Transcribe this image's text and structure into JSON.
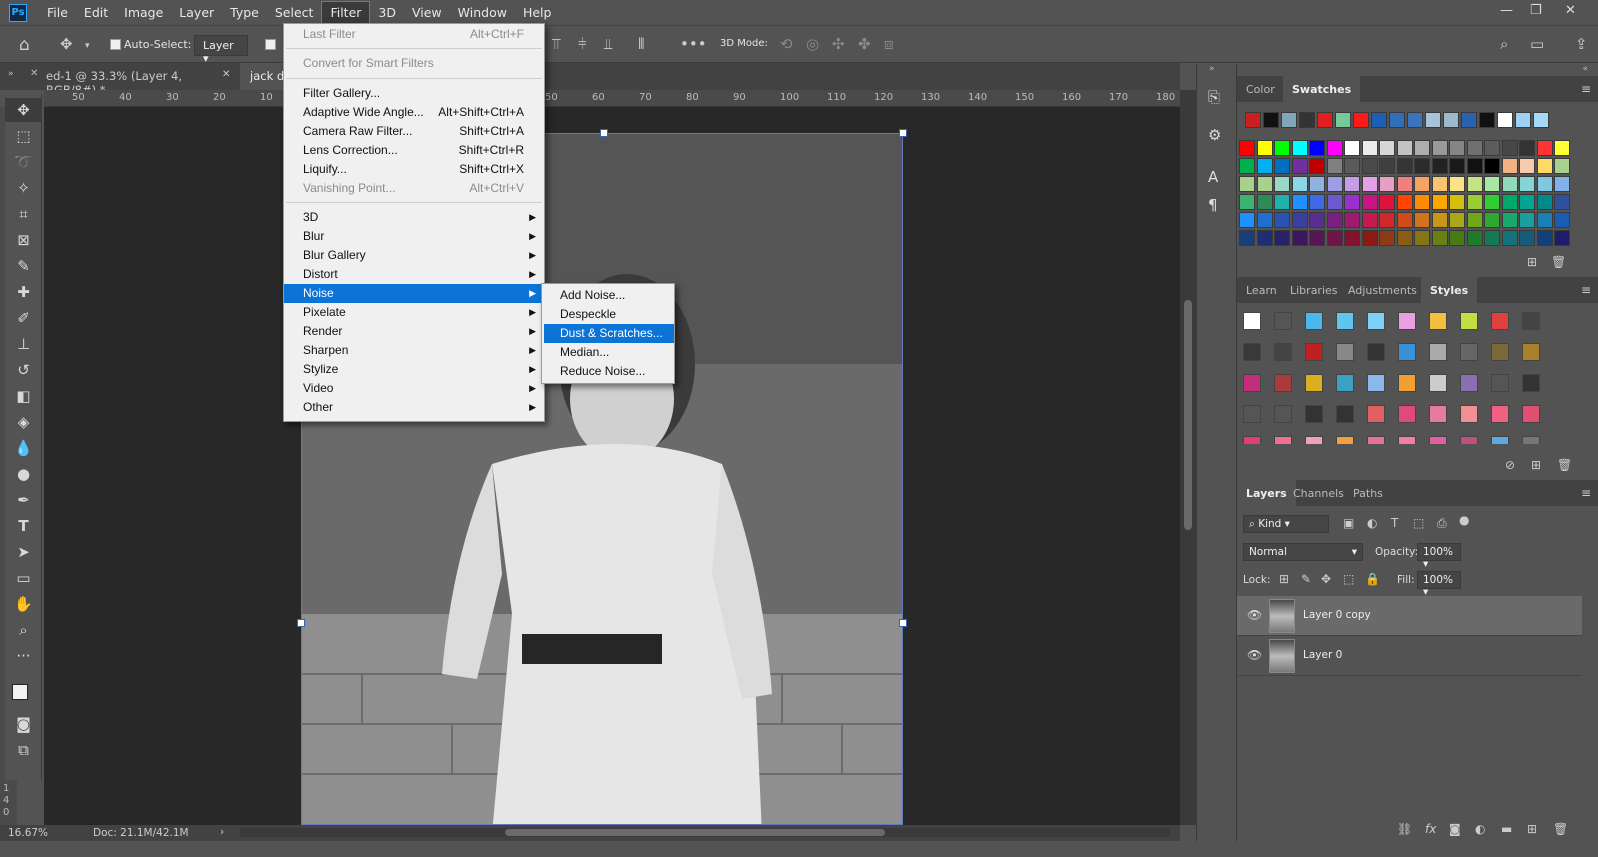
{
  "menubar": {
    "logo": "Ps",
    "items": [
      "File",
      "Edit",
      "Image",
      "Layer",
      "Type",
      "Select",
      "Filter",
      "3D",
      "View",
      "Window",
      "Help"
    ]
  },
  "options": {
    "auto_select_label": "Auto-Select:",
    "auto_select_value": "Layer",
    "mode_label": "3D Mode:"
  },
  "doc_tabs": [
    "ed-1 @ 33.3% (Layer 4, RGB/8#) *",
    "jack da"
  ],
  "ruler_h": [
    "50",
    "40",
    "30",
    "20",
    "10",
    "50",
    "60",
    "70",
    "80",
    "90",
    "100",
    "110",
    "120",
    "130",
    "140",
    "150",
    "160",
    "170",
    "180"
  ],
  "ruler_v": [
    "1",
    "4",
    "0"
  ],
  "filter_menu": {
    "items": [
      {
        "label": "Last Filter",
        "shortcut": "Alt+Ctrl+F",
        "disabled": true
      },
      {
        "label": "Convert for Smart Filters",
        "disabled": true
      },
      {
        "label": "Filter Gallery..."
      },
      {
        "label": "Adaptive Wide Angle...",
        "shortcut": "Alt+Shift+Ctrl+A"
      },
      {
        "label": "Camera Raw Filter...",
        "shortcut": "Shift+Ctrl+A"
      },
      {
        "label": "Lens Correction...",
        "shortcut": "Shift+Ctrl+R"
      },
      {
        "label": "Liquify...",
        "shortcut": "Shift+Ctrl+X"
      },
      {
        "label": "Vanishing Point...",
        "shortcut": "Alt+Ctrl+V",
        "disabled": true
      },
      {
        "label": "3D"
      },
      {
        "label": "Blur"
      },
      {
        "label": "Blur Gallery"
      },
      {
        "label": "Distort"
      },
      {
        "label": "Noise"
      },
      {
        "label": "Pixelate"
      },
      {
        "label": "Render"
      },
      {
        "label": "Sharpen"
      },
      {
        "label": "Stylize"
      },
      {
        "label": "Video"
      },
      {
        "label": "Other"
      }
    ]
  },
  "noise_submenu": [
    "Add Noise...",
    "Despeckle",
    "Dust & Scratches...",
    "Median...",
    "Reduce Noise..."
  ],
  "status": {
    "zoom": "16.67%",
    "doc": "Doc: 21.1M/42.1M"
  },
  "panels": {
    "swatch_tabs": [
      "Color",
      "Swatches"
    ],
    "style_tabs": [
      "Learn",
      "Libraries",
      "Adjustments",
      "Styles"
    ],
    "layer_tabs": [
      "Layers",
      "Channels",
      "Paths"
    ],
    "kind_label": "Kind",
    "blend_mode": "Normal",
    "opacity_label": "Opacity:",
    "opacity_value": "100%",
    "lock_label": "Lock:",
    "fill_label": "Fill:",
    "fill_value": "100%",
    "layers": [
      "Layer 0 copy",
      "Layer 0"
    ]
  },
  "colors": {
    "recent_swatches": [
      "#cc1f1f",
      "#111111",
      "#7fa7b8",
      "#333333",
      "#e02020",
      "#78c99a",
      "#ff1a1a",
      "#1e5fb3",
      "#2f6fb8",
      "#3c74bb",
      "#a8c3d7",
      "#9fb9cc",
      "#2b62ad",
      "#111111",
      "#ffffff",
      "#9cd0f5",
      "#a6d8f7"
    ],
    "swatch_grid": [
      [
        "#ff0000",
        "#ffff00",
        "#00ff00",
        "#00ffff",
        "#0000ff",
        "#ff00ff",
        "#ffffff",
        "#ebebeb",
        "#d6d6d6",
        "#c2c2c2",
        "#adadad",
        "#999999",
        "#858585",
        "#707070",
        "#5c5c5c",
        "#474747",
        "#333333",
        "#ff3333",
        "#ffff33"
      ],
      [
        "#00b050",
        "#00b0f0",
        "#0070c0",
        "#7030a0",
        "#c00000",
        "#808080",
        "#5a5a5a",
        "#4a4a4a",
        "#3f3f3f",
        "#353535",
        "#2c2c2c",
        "#222222",
        "#1a1a1a",
        "#111111",
        "#000000",
        "#f4b183",
        "#f8cbad",
        "#ffd966",
        "#a9d18e"
      ],
      [
        "#a9d18e",
        "#a9d18e",
        "#9bd7c6",
        "#8ad5e6",
        "#8fb4e3",
        "#9e9ee6",
        "#c49ee6",
        "#e69ee6",
        "#e69ec4",
        "#f08080",
        "#f4a460",
        "#f8c471",
        "#fce38a",
        "#c5e384",
        "#a8e6a3",
        "#8fd9b6",
        "#84d6d6",
        "#7ec8e3",
        "#82b0e8"
      ],
      [
        "#3cb371",
        "#2e8b57",
        "#20b2aa",
        "#1e90ff",
        "#4169e1",
        "#6a5acd",
        "#9932cc",
        "#c71585",
        "#dc143c",
        "#ff4500",
        "#ff8c00",
        "#ffa500",
        "#d4c00c",
        "#9acd32",
        "#32cd32",
        "#00a86b",
        "#00a693",
        "#008b8b",
        "#2f4f9f"
      ],
      [
        "#1e90ff",
        "#1f6fd1",
        "#2952b3",
        "#3b3fa0",
        "#5a2d91",
        "#7a1f84",
        "#9e1a6e",
        "#c41a4f",
        "#d1262a",
        "#d14b1a",
        "#d1731a",
        "#c9961a",
        "#a8a81a",
        "#6fa81a",
        "#2fa82f",
        "#1aa86f",
        "#1a9f9f",
        "#1a7fb5",
        "#1a5cb5"
      ],
      [
        "#173f7a",
        "#1d2f6e",
        "#2a2166",
        "#3d175e",
        "#561656",
        "#6d1448",
        "#84122f",
        "#8c1a14",
        "#8c3b14",
        "#8c5c14",
        "#857514",
        "#6b8014",
        "#4a7a14",
        "#1f7a2a",
        "#147a55",
        "#14727a",
        "#145c7a",
        "#14407a",
        "#1d1d6b"
      ]
    ]
  },
  "icons": {
    "home": "home-icon",
    "move": "move-icon",
    "search": "search-icon"
  }
}
